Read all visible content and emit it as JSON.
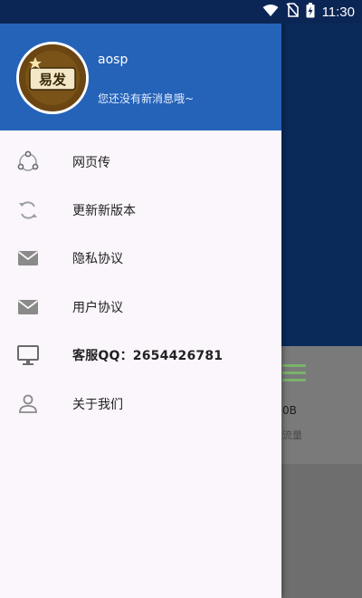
{
  "status_bar": {
    "time": "11:30",
    "icons": [
      "wifi-icon",
      "no-sim-icon",
      "battery-charging-icon"
    ]
  },
  "drawer": {
    "header": {
      "avatar_text": "易发",
      "username": "aosp",
      "subtitle": "您还没有新消息哦~",
      "background_color": "#2563b9"
    },
    "menu": [
      {
        "label": "网页传",
        "icon": "share-icon"
      },
      {
        "label": "更新新版本",
        "icon": "sync-icon"
      },
      {
        "label": "隐私协议",
        "icon": "mail-icon"
      },
      {
        "label": "用户协议",
        "icon": "mail-icon"
      },
      {
        "label": "客服QQ：2654426781",
        "icon": "monitor-icon"
      },
      {
        "label": "关于我们",
        "icon": "person-icon"
      }
    ]
  },
  "background_app": {
    "card_value": "0B",
    "card_caption": "流量"
  }
}
